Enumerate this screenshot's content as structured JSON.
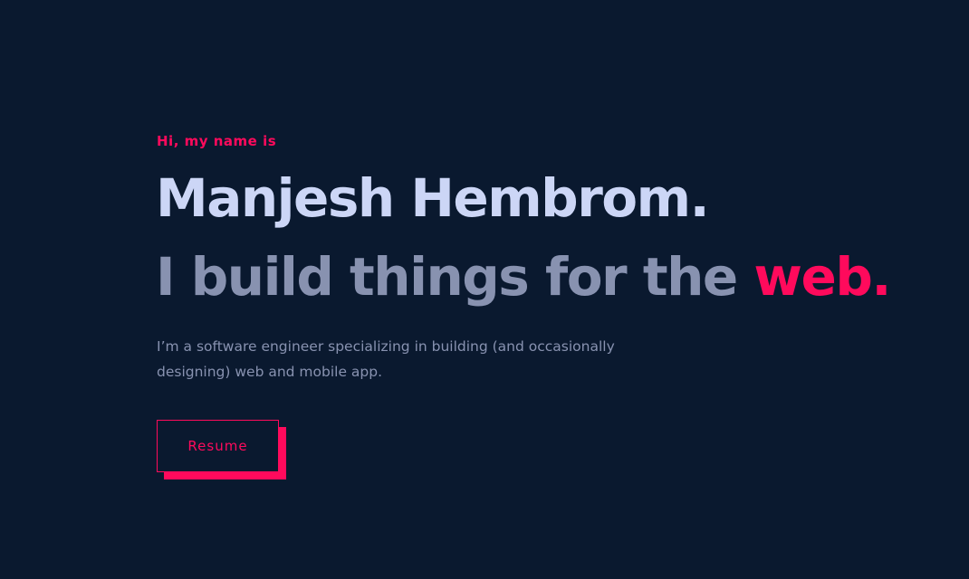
{
  "hero": {
    "greeting": "Hi, my name is",
    "name": "Manjesh Hembrom.",
    "tagline_main": "I build things for the ",
    "tagline_accent": "web.",
    "description": "I’m a software engineer specializing in building (and occasionally designing) web and mobile app.",
    "resume_label": "Resume"
  },
  "colors": {
    "background": "#0a192f",
    "accent": "#ff0a5c",
    "heading": "#ccd6f6",
    "muted": "#8892b0"
  }
}
